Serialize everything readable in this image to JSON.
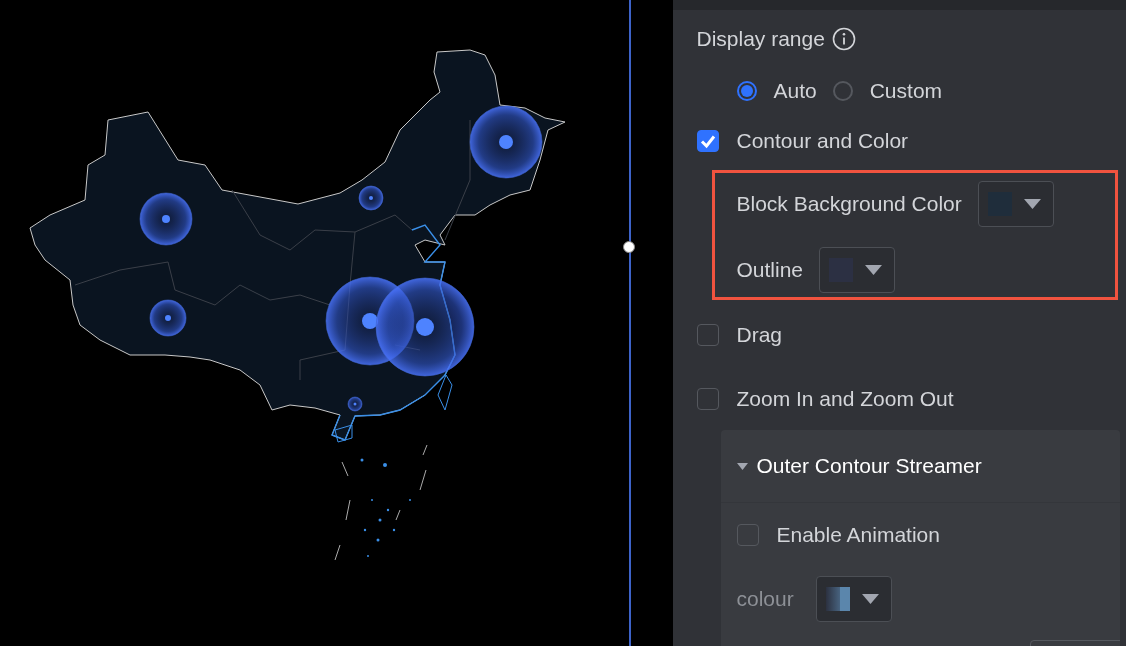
{
  "display_range": {
    "label": "Display range",
    "options": [
      {
        "label": "Auto",
        "selected": true
      },
      {
        "label": "Custom",
        "selected": false
      }
    ]
  },
  "contour": {
    "label": "Contour and Color",
    "checked": true,
    "highlighted": true,
    "pickers": [
      {
        "label": "Block Background Color",
        "color": "#1f2d3b"
      },
      {
        "label": "Outline",
        "color": "#2c3043"
      }
    ]
  },
  "options": [
    {
      "label": "Drag",
      "checked": false
    },
    {
      "label": "Zoom In and Zoom Out",
      "checked": false
    }
  ],
  "section": {
    "title": "Outer Contour Streamer",
    "expanded": true,
    "items": [
      {
        "kind": "checkbox",
        "label": "Enable Animation",
        "checked": false
      },
      {
        "kind": "color",
        "label": "colour",
        "color": "#5b86ac",
        "disabled": true
      },
      {
        "kind": "field"
      }
    ]
  }
}
